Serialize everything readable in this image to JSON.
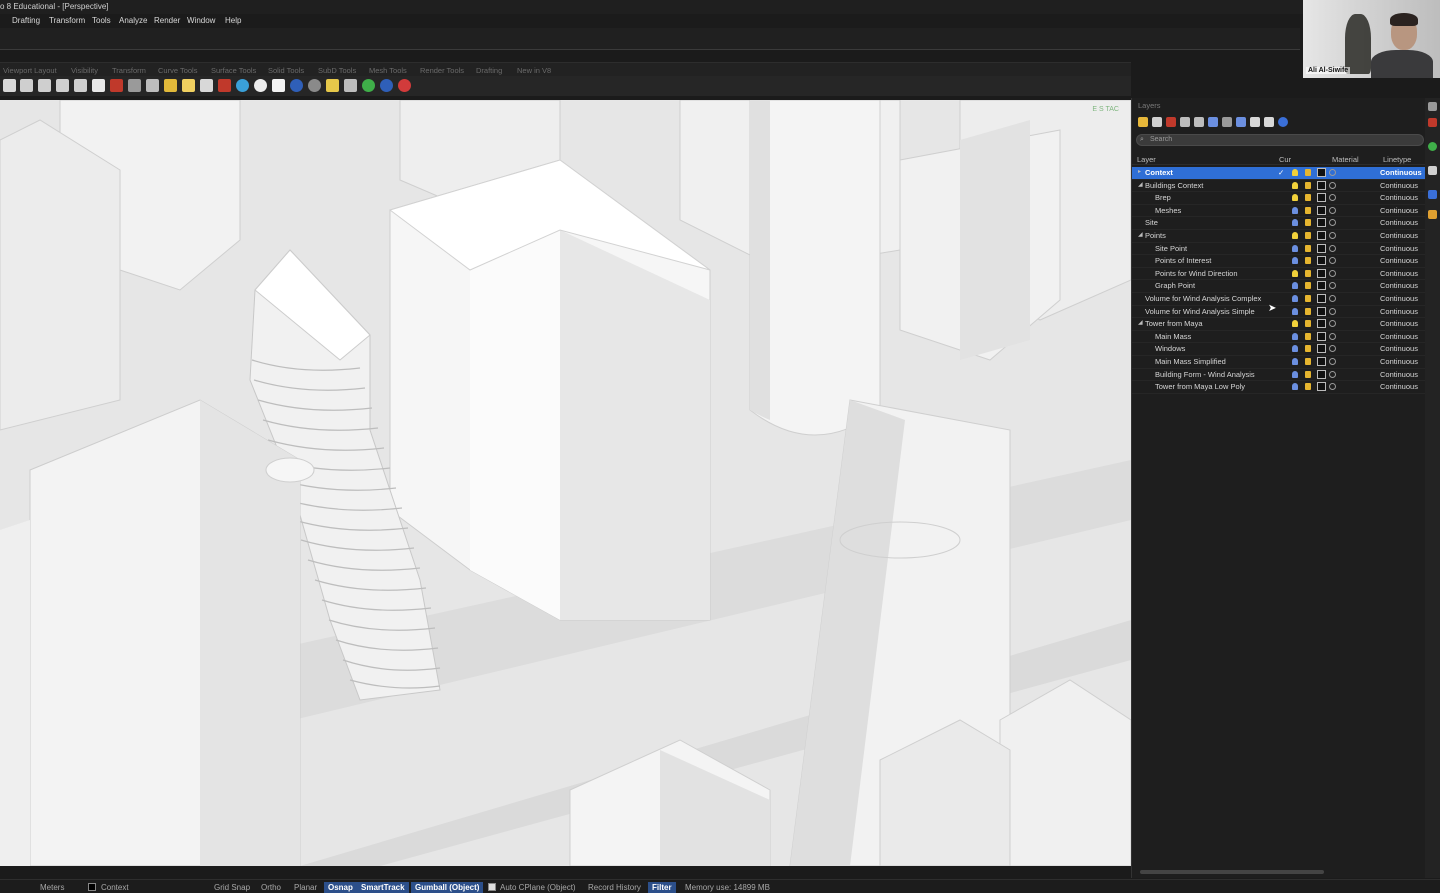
{
  "window": {
    "title": "o 8 Educational - [Perspective]"
  },
  "menu": [
    "Drafting",
    "Transform",
    "Tools",
    "Analyze",
    "Render",
    "Window",
    "Help"
  ],
  "toolbar_tabs": [
    "Viewport Layout",
    "Visibility",
    "Transform",
    "Curve Tools",
    "Surface Tools",
    "Solid Tools",
    "SubD Tools",
    "Mesh Tools",
    "Render Tools",
    "Drafting",
    "New in V8"
  ],
  "viewport": {
    "name": "Perspective",
    "corner_label": "E S TAC"
  },
  "layers_panel": {
    "title": "Layers",
    "search_placeholder": "Search",
    "columns": {
      "layer": "Layer",
      "current": "Cur",
      "material": "Material",
      "linetype": "Linetype"
    },
    "rows": [
      {
        "name": "Context",
        "level": 0,
        "expander": "▸",
        "selected": true,
        "bulb": "#f2d13a",
        "linetype": "Continuous",
        "current": "✓"
      },
      {
        "name": "Buildings Context",
        "level": 0,
        "expander": "◢",
        "selected": false,
        "bulb": "#f2d13a",
        "linetype": "Continuous"
      },
      {
        "name": "Brep",
        "level": 1,
        "expander": "",
        "selected": false,
        "bulb": "#f2d13a",
        "linetype": "Continuous"
      },
      {
        "name": "Meshes",
        "level": 1,
        "expander": "",
        "selected": false,
        "bulb": "#6b8fe0",
        "linetype": "Continuous"
      },
      {
        "name": "Site",
        "level": 0,
        "expander": "",
        "selected": false,
        "bulb": "#6b8fe0",
        "linetype": "Continuous"
      },
      {
        "name": "Points",
        "level": 0,
        "expander": "◢",
        "selected": false,
        "bulb": "#f2d13a",
        "linetype": "Continuous"
      },
      {
        "name": "Site Point",
        "level": 1,
        "expander": "",
        "selected": false,
        "bulb": "#6b8fe0",
        "linetype": "Continuous"
      },
      {
        "name": "Points of Interest",
        "level": 1,
        "expander": "",
        "selected": false,
        "bulb": "#6b8fe0",
        "linetype": "Continuous"
      },
      {
        "name": "Points for Wind Direction",
        "level": 1,
        "expander": "",
        "selected": false,
        "bulb": "#f2d13a",
        "linetype": "Continuous"
      },
      {
        "name": "Graph Point",
        "level": 1,
        "expander": "",
        "selected": false,
        "bulb": "#6b8fe0",
        "linetype": "Continuous"
      },
      {
        "name": "Volume for Wind Analysis Complex",
        "level": 0,
        "expander": "",
        "selected": false,
        "bulb": "#6b8fe0",
        "linetype": "Continuous"
      },
      {
        "name": "Volume for Wind Analysis Simple",
        "level": 0,
        "expander": "",
        "selected": false,
        "bulb": "#6b8fe0",
        "linetype": "Continuous"
      },
      {
        "name": "Tower from Maya",
        "level": 0,
        "expander": "◢",
        "selected": false,
        "bulb": "#f2d13a",
        "linetype": "Continuous"
      },
      {
        "name": "Main Mass",
        "level": 1,
        "expander": "",
        "selected": false,
        "bulb": "#6b8fe0",
        "linetype": "Continuous"
      },
      {
        "name": "Windows",
        "level": 1,
        "expander": "",
        "selected": false,
        "bulb": "#6b8fe0",
        "linetype": "Continuous"
      },
      {
        "name": "Main Mass Simplified",
        "level": 1,
        "expander": "",
        "selected": false,
        "bulb": "#6b8fe0",
        "linetype": "Continuous"
      },
      {
        "name": "Building Form - Wind Analysis",
        "level": 1,
        "expander": "",
        "selected": false,
        "bulb": "#6b8fe0",
        "linetype": "Continuous"
      },
      {
        "name": "Tower from Maya Low Poly",
        "level": 1,
        "expander": "",
        "selected": false,
        "bulb": "#6b8fe0",
        "linetype": "Continuous"
      }
    ]
  },
  "webcam": {
    "participant_name": "Ali Al-Siwife"
  },
  "status_bar": {
    "units": "Meters",
    "layer": "Context",
    "items": [
      {
        "label": "Grid Snap",
        "on": false
      },
      {
        "label": "Ortho",
        "on": false
      },
      {
        "label": "Planar",
        "on": false
      },
      {
        "label": "Osnap",
        "on": true
      },
      {
        "label": "SmartTrack",
        "on": true
      },
      {
        "label": "Gumball (Object)",
        "on": true
      },
      {
        "label": "Auto CPlane (Object)",
        "on": false
      },
      {
        "label": "Record History",
        "on": false
      },
      {
        "label": "Filter",
        "on": true
      }
    ],
    "memory": "Memory use: 14899 MB"
  },
  "colors": {
    "accent": "#2f6fd6",
    "viewport_bg": "#e9e9e9",
    "panel_bg": "#1e1e1e"
  }
}
